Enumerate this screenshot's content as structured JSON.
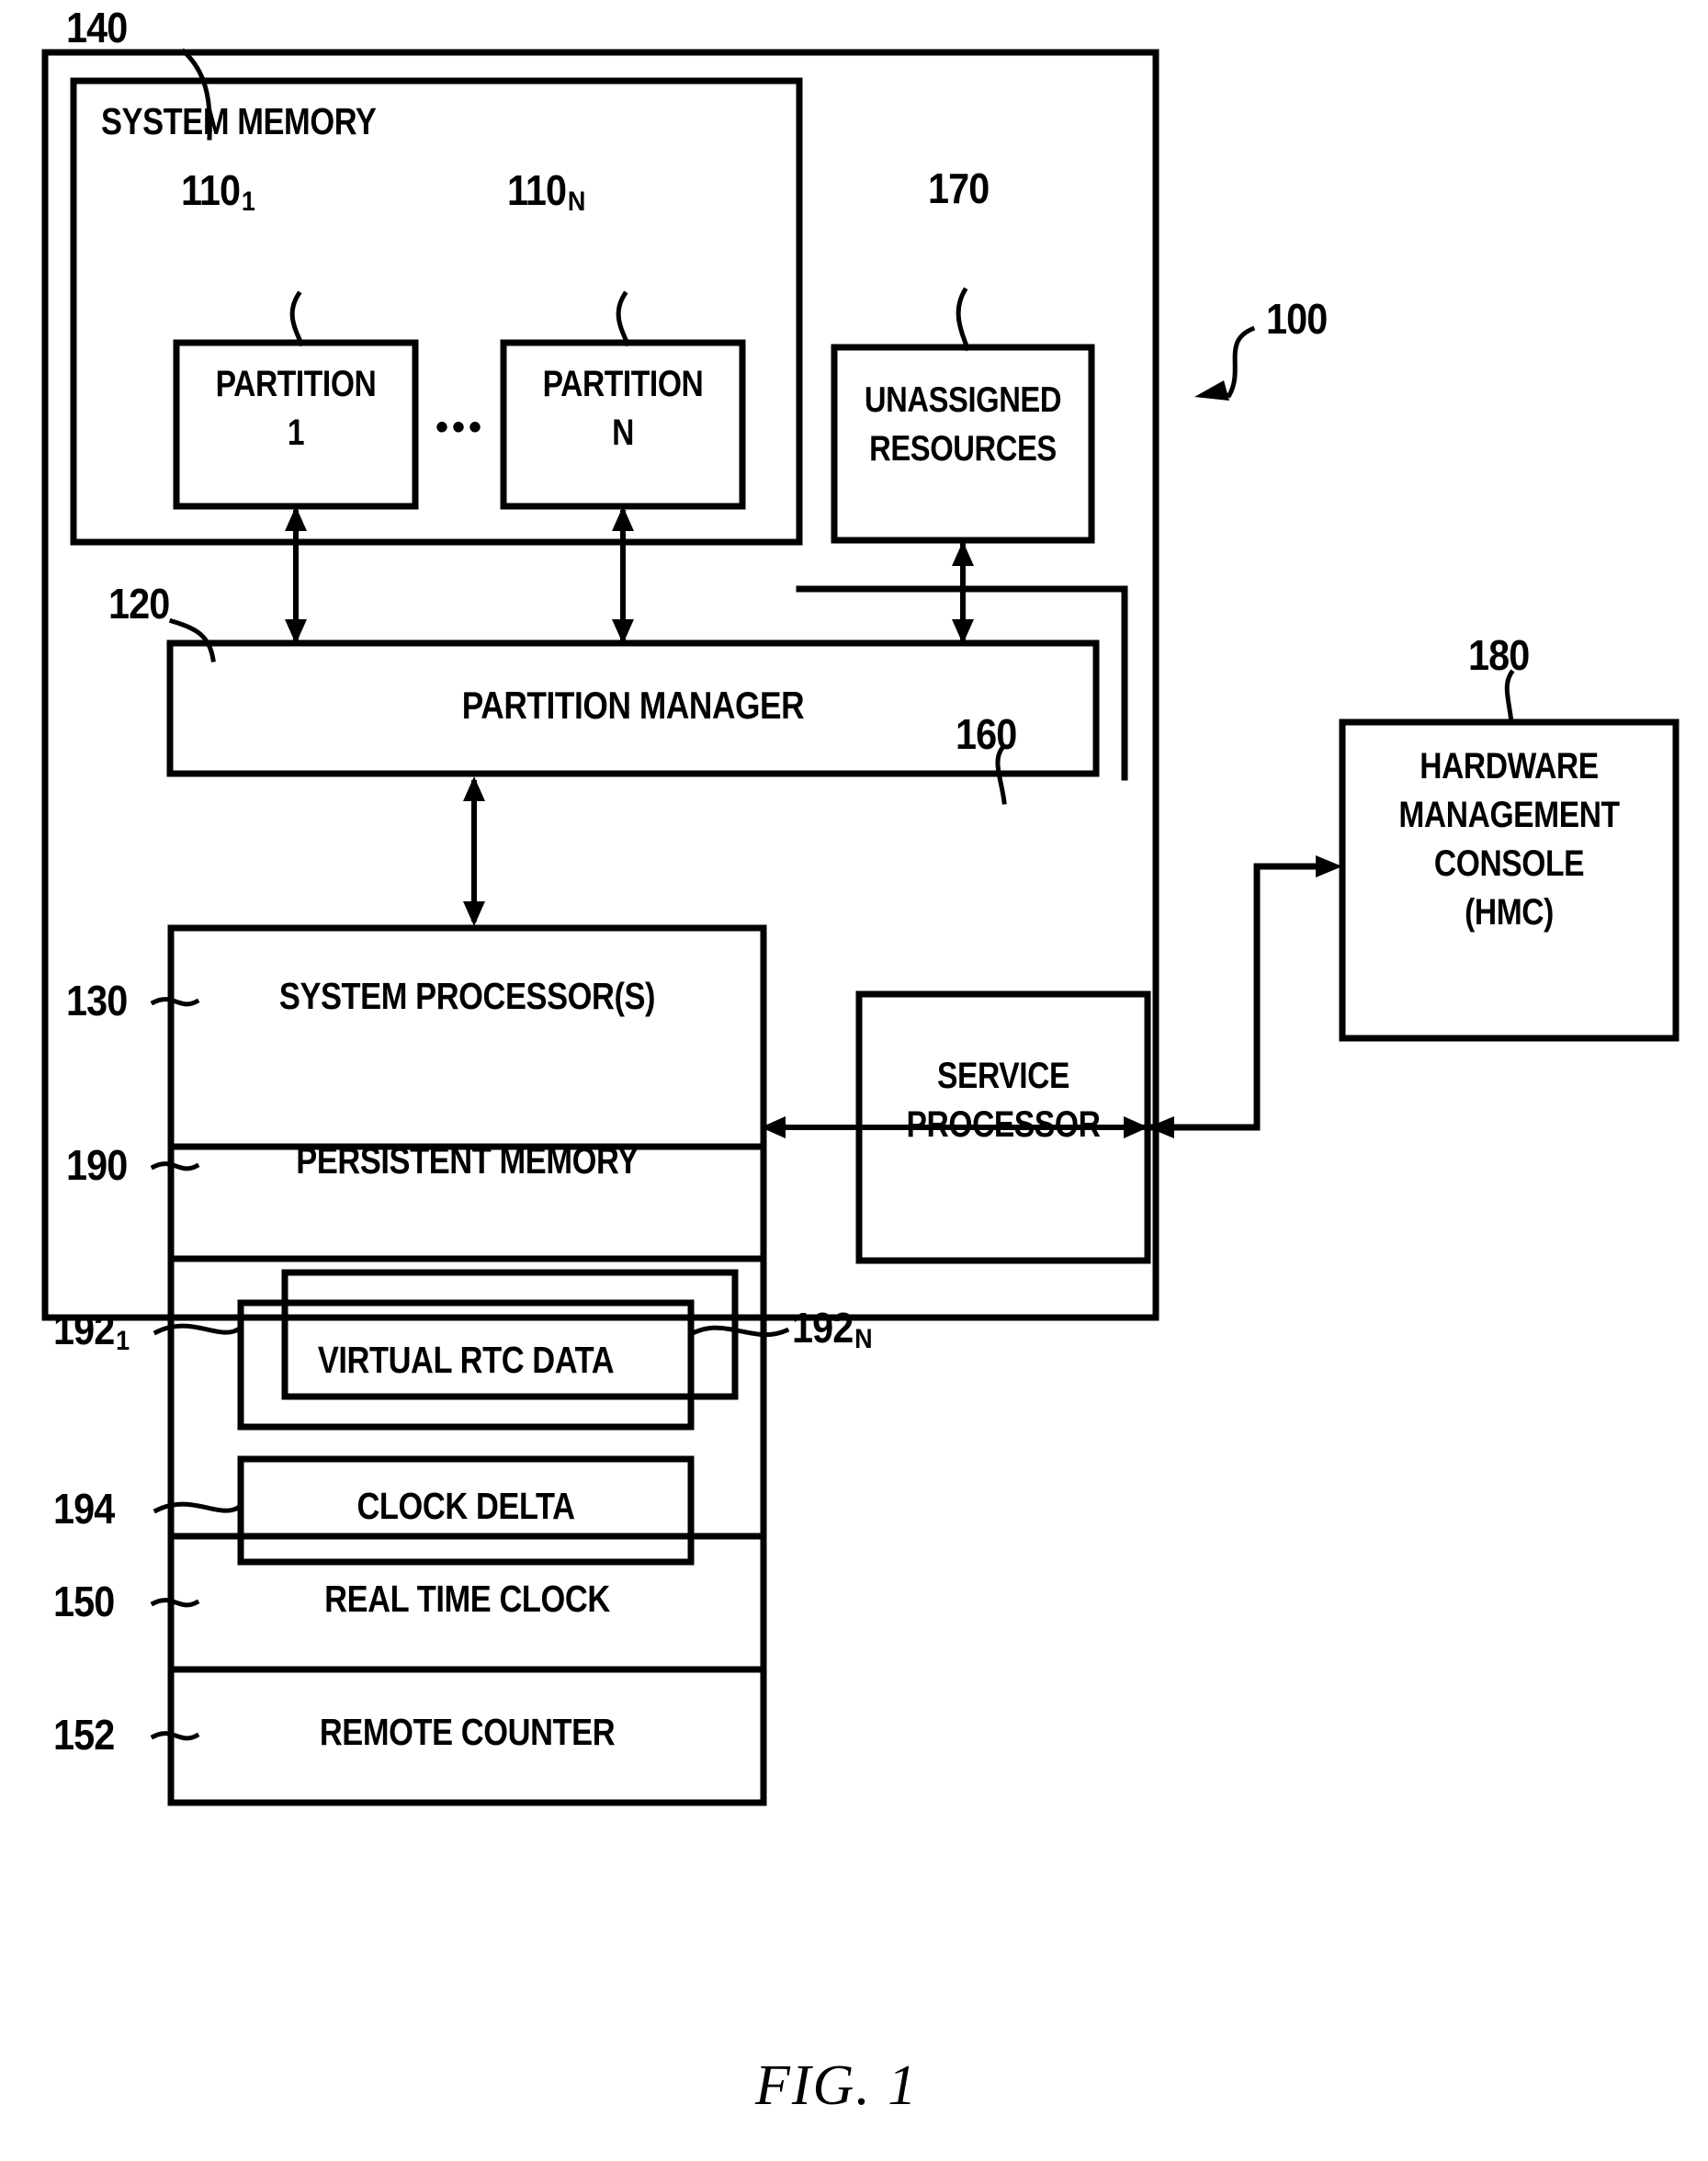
{
  "figure": {
    "caption": "FIG. 1",
    "system_ref": "100"
  },
  "outer_system": {
    "ref": "140",
    "label": "SYSTEM MEMORY"
  },
  "partitions": [
    {
      "ref": "110",
      "sub": "1",
      "line1": "PARTITION",
      "line2": "1"
    },
    {
      "ref": "110",
      "sub": "N",
      "line1": "PARTITION",
      "line2": "N"
    }
  ],
  "partition_ellipsis": "•••",
  "unassigned_resources": {
    "ref": "170",
    "line1": "UNASSIGNED",
    "line2": "RESOURCES"
  },
  "partition_manager": {
    "ref": "120",
    "label": "PARTITION MANAGER"
  },
  "system_processor": {
    "ref": "130",
    "label": "SYSTEM PROCESSOR(S)"
  },
  "persistent_memory": {
    "ref": "190",
    "label": "PERSISTENT MEMORY"
  },
  "virtual_rtc": {
    "ref_first": "192",
    "sub_first": "1",
    "ref_last": "192",
    "sub_last": "N",
    "label": "VIRTUAL RTC DATA"
  },
  "clock_delta": {
    "ref": "194",
    "label": "CLOCK DELTA"
  },
  "real_time_clock": {
    "ref": "150",
    "label": "REAL TIME CLOCK"
  },
  "remote_counter": {
    "ref": "152",
    "label": "REMOTE COUNTER"
  },
  "service_processor": {
    "ref": "160",
    "line1": "SERVICE",
    "line2": "PROCESSOR"
  },
  "hmc": {
    "ref": "180",
    "line1": "HARDWARE",
    "line2": "MANAGEMENT",
    "line3": "CONSOLE",
    "line4": "(HMC)"
  },
  "style": {
    "ink": "#000000",
    "paper": "#ffffff"
  }
}
